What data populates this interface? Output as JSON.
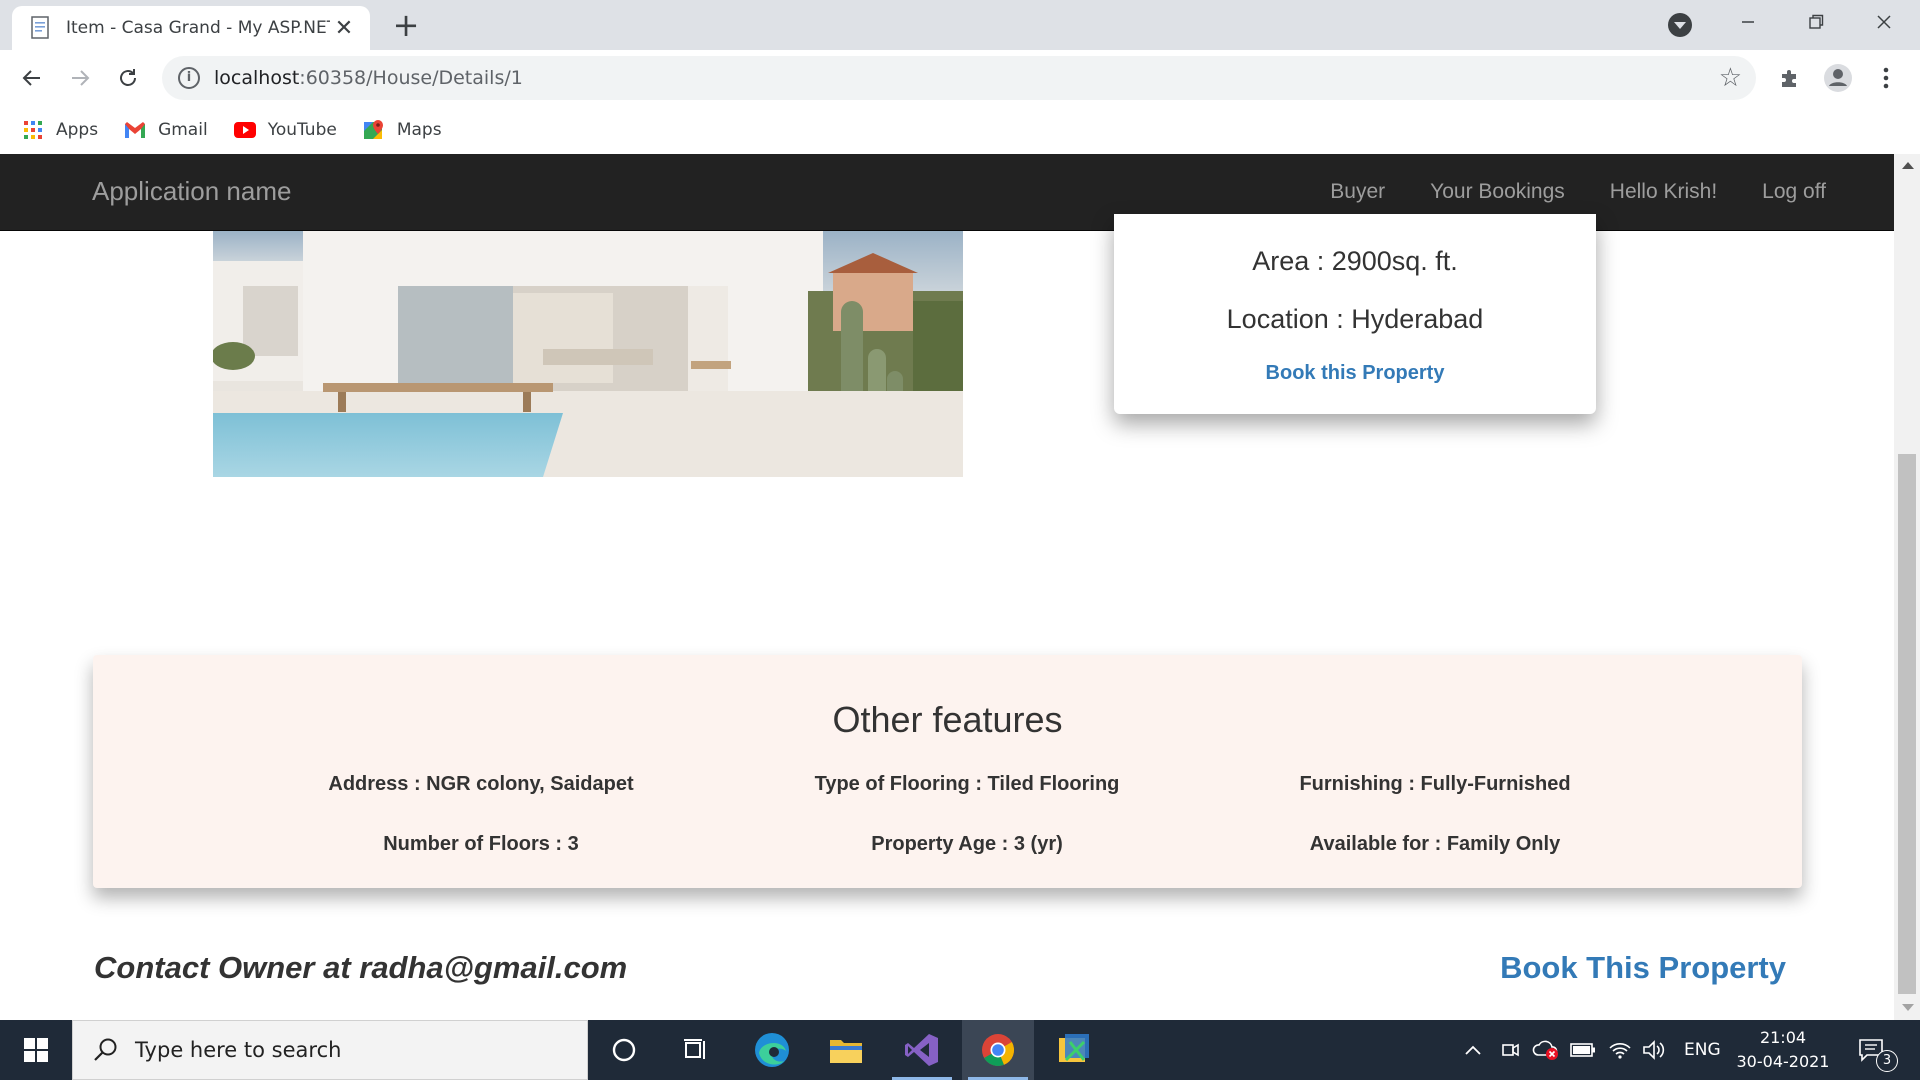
{
  "browser": {
    "tab_title": "Item - Casa Grand - My ASP.NET Application",
    "tab_close": "✕",
    "new_tab": "+",
    "url_host": "localhost",
    "url_rest": ":60358/House/Details/1",
    "bookmarks": [
      {
        "label": "Apps",
        "icon": "apps-grid-icon"
      },
      {
        "label": "Gmail",
        "icon": "gmail-icon"
      },
      {
        "label": "YouTube",
        "icon": "youtube-icon"
      },
      {
        "label": "Maps",
        "icon": "maps-icon"
      }
    ]
  },
  "site": {
    "brand": "Application name",
    "nav": [
      "Buyer",
      "Your Bookings",
      "Hello Krish!",
      "Log off"
    ]
  },
  "property": {
    "area": "Area : 2900sq. ft.",
    "location": "Location : Hyderabad",
    "book_link": "Book this Property"
  },
  "features": {
    "title": "Other features",
    "items": [
      "Address : NGR colony, Saidapet",
      "Type of Flooring : Tiled Flooring",
      "Furnishing : Fully-Furnished",
      "Number of Floors : 3",
      "Property Age : 3 (yr)",
      "Available for : Family Only"
    ]
  },
  "contact": "Contact Owner at radha@gmail.com",
  "book_big": "Book This Property",
  "taskbar": {
    "search_placeholder": "Type here to search",
    "language": "ENG",
    "time": "21:04",
    "date": "30-04-2021",
    "notification_count": "3"
  },
  "colors": {
    "navbar": "#222222",
    "link": "#337ab7",
    "features_bg": "#fdf3ef",
    "taskbar": "#1f2a38"
  }
}
